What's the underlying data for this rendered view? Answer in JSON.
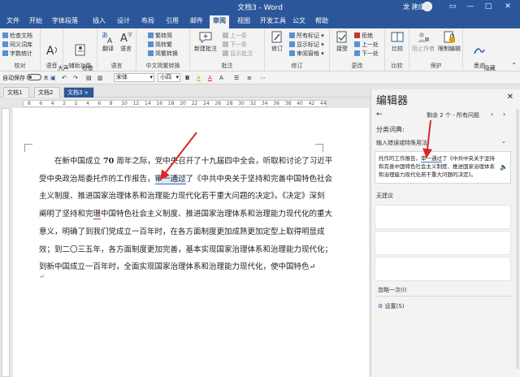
{
  "window": {
    "title": "文档3 - Word",
    "user": "龙 建成",
    "min": "—",
    "max": "□",
    "close": "✕",
    "ribbon_opts": "▭"
  },
  "menu": [
    "文件",
    "开始",
    "字体段落",
    "插入",
    "设计",
    "布局",
    "引用",
    "邮件",
    "审阅",
    "视图",
    "开发工具",
    "公文",
    "帮助"
  ],
  "menu_active_index": 8,
  "ribbon": {
    "groups": [
      {
        "label": "校对",
        "items": [
          "检查文档",
          "同义词库",
          "字数统计"
        ]
      },
      {
        "label": "语音",
        "big": "大声\n朗读"
      },
      {
        "label": "辅助功能",
        "big": "检查\n辅助功能"
      },
      {
        "label": "语言",
        "big": "翻译",
        "big2": "语言"
      },
      {
        "label": "中文简繁转换",
        "items": [
          "繁转简",
          "简转繁",
          "简繁转换"
        ]
      },
      {
        "label": "批注",
        "big": "新建批注",
        "items": [
          "上一条",
          "下一条",
          "显示批注"
        ]
      },
      {
        "label": "修订",
        "big": "修订",
        "items": [
          "所有标记",
          "显示标记",
          "审阅窗格"
        ]
      },
      {
        "label": "更改",
        "big": "接受",
        "items": [
          "拒绝",
          "上一处",
          "下一处"
        ]
      },
      {
        "label": "比较",
        "big": "比较"
      },
      {
        "label": "保护",
        "big": "阻止作者",
        "big2": "限制编辑"
      },
      {
        "label": "墨迹",
        "big": "隐藏\n墨迹"
      }
    ]
  },
  "qat": {
    "autosave": "自动保存",
    "toggle_state": "关",
    "font": "宋体",
    "size": "小四",
    "format_labels": [
      "B",
      "A",
      "A",
      "A"
    ]
  },
  "doc_tabs": [
    {
      "label": "文档1",
      "active": false
    },
    {
      "label": "文档2",
      "active": false
    },
    {
      "label": "文档3",
      "active": true
    }
  ],
  "ruler_numbers": [
    "8",
    "6",
    "4",
    "2",
    "2",
    "4",
    "6",
    "8",
    "10",
    "12",
    "14",
    "16",
    "18",
    "20",
    "22",
    "24",
    "26",
    "28",
    "30",
    "32",
    "34",
    "36",
    "38",
    "40",
    "42",
    "44"
  ],
  "document": {
    "lines": [
      {
        "pre": "在新中国成立 ",
        "bold": "70",
        "post": " 周年之际，党中央召开了十九届四中全会，听取和讨论了习近平"
      },
      {
        "pre": "受中央政治局委托作的工作报告，",
        "hl": "审一通过",
        "post": "了《中共中央关于坚持和完善中国特色社会"
      },
      {
        "pre": "主义制度、推进国家治理体系和治理能力现代化若干重大问题的决定》。《决定》深刻"
      },
      {
        "pre": "阐明了坚持和完",
        "red": "珊",
        "post": "中国特色社会主义制度、推进国家治理体系和治理能力现代化的重大"
      },
      {
        "pre": "意义，明确了到我们党成立一百年时，在各方面制度更加成熟更加定型上取得明显成"
      },
      {
        "pre": "效；到二〇三五年，各方面制度更加完善，基本实现国家治理体系和治理能力现代化；"
      },
      {
        "pre": "到新中国成立一百年时，全面实现国家治理体系和治理能力现代化，使中国特色↵"
      }
    ],
    "empty_mark": "↵"
  },
  "pane": {
    "title": "编辑器",
    "close": "✕",
    "nav": "剩余 2 个 - 所有问题",
    "section": "分类词典:",
    "suggest_title": "输入错误或特殊用法",
    "context": {
      "pre": "托作的工作报告，",
      "hl": "审一通过",
      "post": "了《中共中央关于坚持和完善中国特色社会主义制度、推进国家治理体系和治理能力现代化若干重大问题的决定》。"
    },
    "no_suggestions": "无建议",
    "ignore": "忽略一次(I)",
    "settings": "设置(S)"
  },
  "colors": {
    "brand": "#2b579a",
    "arrow": "#d9262c",
    "highlight": "#3a6fc4"
  }
}
